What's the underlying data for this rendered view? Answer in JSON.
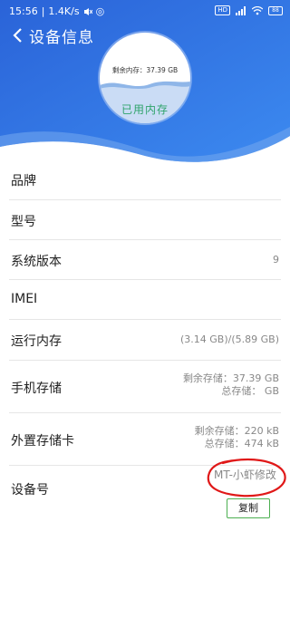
{
  "status_bar": {
    "time": "15:56",
    "network_speed": "1.4K/s",
    "mute_icon": "mute-icon",
    "signal_badge": "HD",
    "battery": "88"
  },
  "header": {
    "title": "设备信息",
    "back_icon": "chevron-left-icon"
  },
  "memory_gauge": {
    "remaining_text": "剩余内存：37.39 GB",
    "used_label": "已用内存",
    "accent_color": "#2fa36b",
    "wave_color": "#8fb6e8"
  },
  "rows": [
    {
      "label": "品牌",
      "value": ""
    },
    {
      "label": "型号",
      "value": ""
    },
    {
      "label": "系统版本",
      "value": "9"
    },
    {
      "label": "IMEI",
      "value": ""
    },
    {
      "label": "运行内存",
      "value": "(3.14 GB)/(5.89 GB)"
    },
    {
      "label": "手机存储",
      "value_line1": "剩余存储：37.39 GB",
      "value_line2": "总存储：      GB"
    },
    {
      "label": "外置存储卡",
      "value_line1": "剩余存储：220 kB",
      "value_line2": "总存储：474 kB"
    },
    {
      "label": "设备号",
      "value": "MT-小虾修改"
    }
  ],
  "copy_button": "复制",
  "colors": {
    "header_blue": "#2f6fe0",
    "annotation_red": "#e01818",
    "copy_border": "#4caf50"
  }
}
